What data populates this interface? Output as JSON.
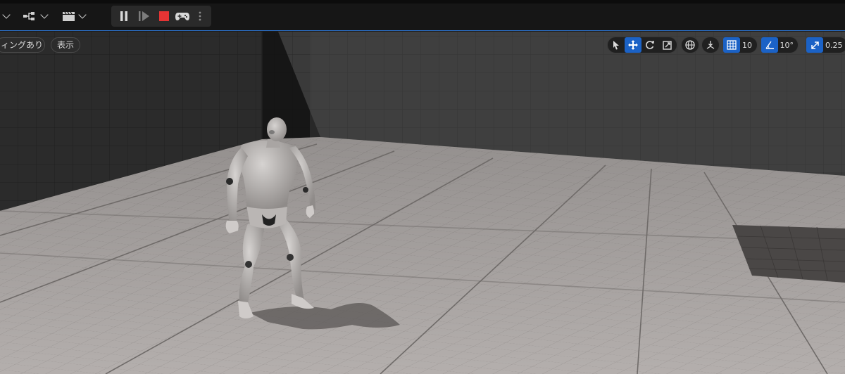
{
  "toolbar": {
    "icons": [
      "chevron-down-icon",
      "blueprint-icon",
      "cinematics-clapper-icon",
      "pause-icon",
      "step-frame-icon",
      "stop-icon",
      "gamepad-icon",
      "more-options-icon"
    ],
    "stop_color": "#e53434",
    "accent": "#2b6ec4"
  },
  "viewport_left": {
    "lighting_label": "ィングあり",
    "show_label": "表示"
  },
  "viewport_right": {
    "transform_tools": [
      "select-icon",
      "move-icon",
      "rotate-icon",
      "scale-icon"
    ],
    "active_tool": "move",
    "world_local_icon": "globe-icon",
    "surface_snap_icon": "surface-snap-icon",
    "grid_snap_value": "10",
    "rotation_snap_value": "10°",
    "scale_snap_value": "0.25",
    "active_color": "#1b62c6"
  }
}
